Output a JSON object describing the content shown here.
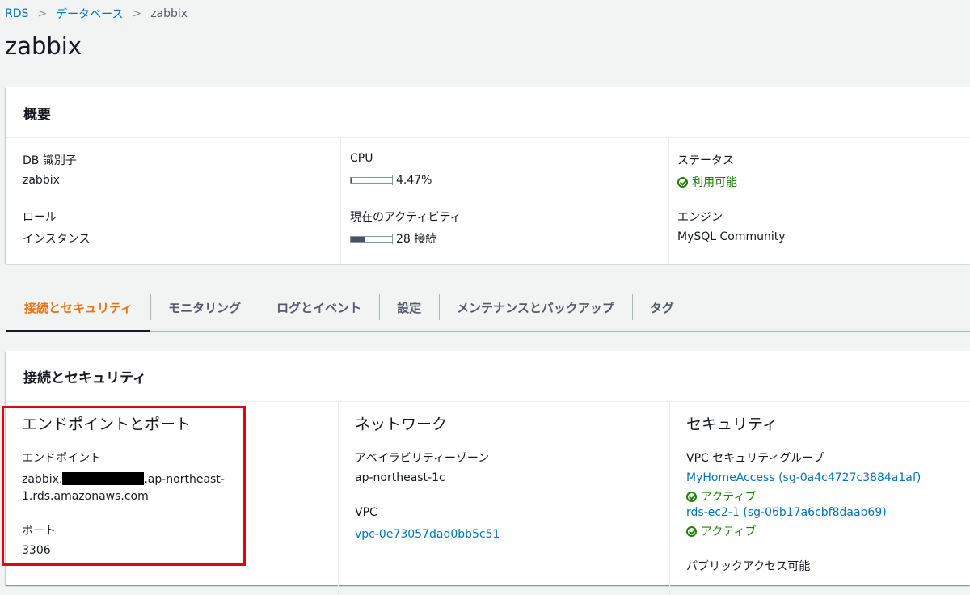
{
  "breadcrumb": {
    "rds": "RDS",
    "databases": "データベース",
    "current": "zabbix"
  },
  "page_title": "zabbix",
  "summary": {
    "title": "概要",
    "db_id_label": "DB 識別子",
    "db_id_value": "zabbix",
    "role_label": "ロール",
    "role_value": "インスタンス",
    "cpu_label": "CPU",
    "cpu_value": "4.47%",
    "cpu_fraction": 0.0447,
    "activity_label": "現在のアクティビティ",
    "activity_value": "28 接続",
    "activity_fraction": 0.35,
    "status_label": "ステータス",
    "status_value": "利用可能",
    "engine_label": "エンジン",
    "engine_value": "MySQL Community"
  },
  "tabs": [
    {
      "label": "接続とセキュリティ",
      "active": true
    },
    {
      "label": "モニタリング"
    },
    {
      "label": "ログとイベント"
    },
    {
      "label": "設定"
    },
    {
      "label": "メンテナンスとバックアップ"
    },
    {
      "label": "タグ"
    }
  ],
  "connectivity": {
    "title": "接続とセキュリティ",
    "endpoint_section": "エンドポイントとポート",
    "endpoint_label": "エンドポイント",
    "endpoint_prefix": "zabbix.",
    "endpoint_suffix": ".ap-northeast-",
    "endpoint_line2": "1.rds.amazonaws.com",
    "port_label": "ポート",
    "port_value": "3306",
    "network_section": "ネットワーク",
    "az_label": "アベイラビリティーゾーン",
    "az_value": "ap-northeast-1c",
    "vpc_label": "VPC",
    "vpc_value": "vpc-0e73057dad0bb5c51",
    "security_section": "セキュリティ",
    "sg_label": "VPC セキュリティグループ",
    "sg1": "MyHomeAccess (sg-0a4c4727c3884a1af)",
    "sg1_status": "アクティブ",
    "sg2": "rds-ec2-1 (sg-06b17a6cbf8daab69)",
    "sg2_status": "アクティブ",
    "public_access_label": "パブリックアクセス可能"
  },
  "colors": {
    "link": "#0073bb",
    "active_tab": "#ec7211",
    "ok": "#1d8102",
    "highlight": "#e8000b"
  }
}
